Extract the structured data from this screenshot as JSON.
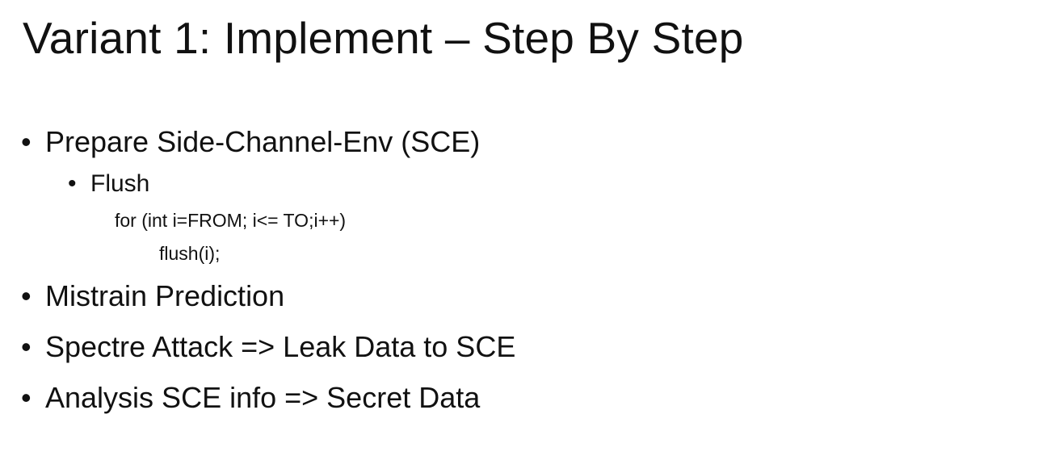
{
  "slide": {
    "title": "Variant 1: Implement – Step By Step",
    "bullet_glyph": "•",
    "items": [
      {
        "text": "Prepare Side-Channel-Env (SCE)",
        "subitems": [
          {
            "text": "Flush",
            "code_lines": [
              "for (int i=FROM; i<= TO;i++)",
              "flush(i);"
            ]
          }
        ]
      },
      {
        "text": "Mistrain Prediction"
      },
      {
        "text": "Spectre Attack => Leak Data to SCE"
      },
      {
        "text": "Analysis SCE info => Secret Data"
      }
    ]
  }
}
